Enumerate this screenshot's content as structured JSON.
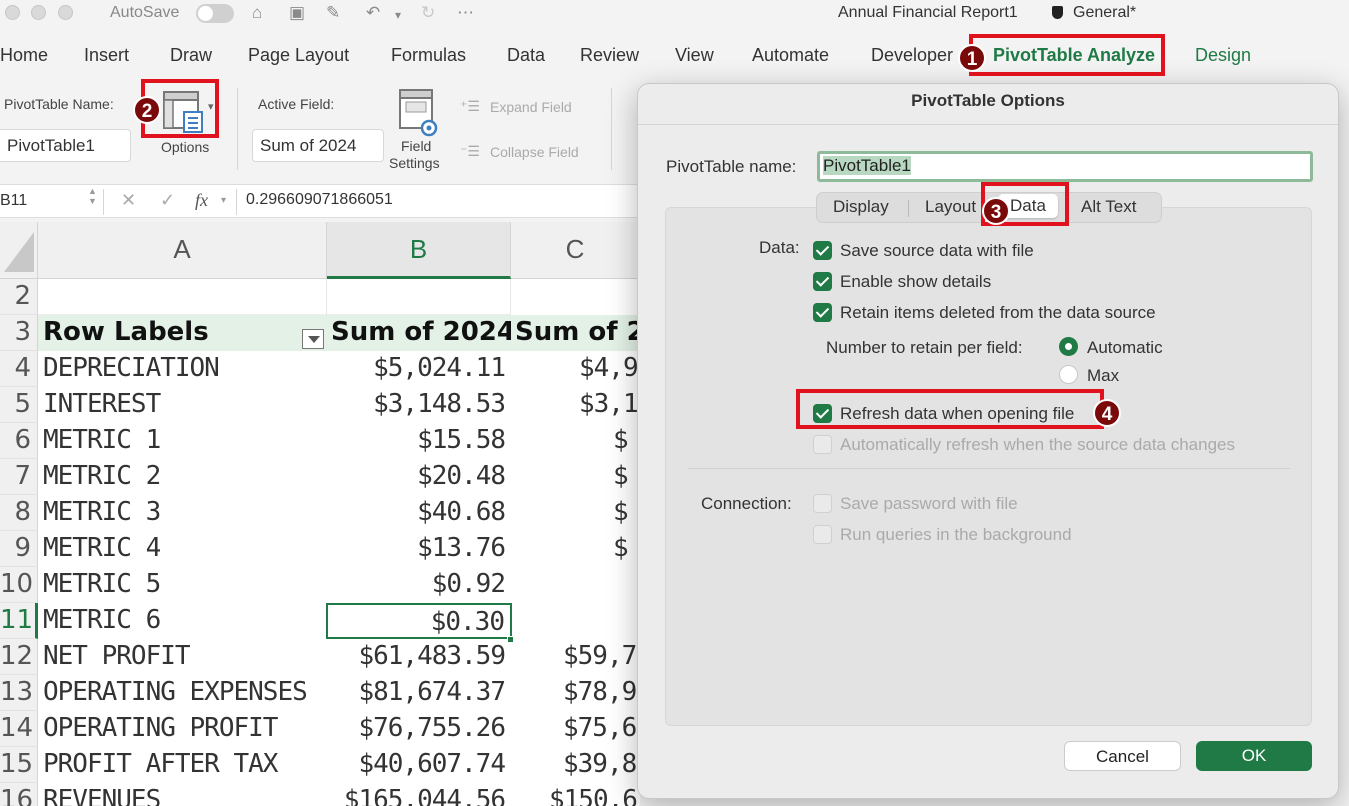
{
  "app": {
    "autosave_label": "AutoSave",
    "doc_title": "Annual Financial Report1",
    "sensitivity": "General*"
  },
  "tabs": [
    "Home",
    "Insert",
    "Draw",
    "Page Layout",
    "Formulas",
    "Data",
    "Review",
    "View",
    "Automate",
    "Developer",
    "PivotTable Analyze",
    "Design"
  ],
  "ribbon": {
    "pivot_name_label": "PivotTable Name:",
    "pivot_name_value": "PivotTable1",
    "options_label": "Options",
    "active_field_label": "Active Field:",
    "active_field_value": "Sum of 2024",
    "field_settings_label_1": "Field",
    "field_settings_label_2": "Settings",
    "expand_field": "Expand Field",
    "collapse_field": "Collapse Field"
  },
  "formula_bar": {
    "name_box": "B11",
    "fx": "fx",
    "value": "0.296609071866051"
  },
  "sheet": {
    "columns": [
      "A",
      "B",
      "C"
    ],
    "header_row": {
      "num": "3",
      "a": "Row Labels",
      "b": "Sum of 2024",
      "c": "Sum of 2"
    },
    "rows": [
      {
        "num": "2",
        "a": "",
        "b": "",
        "c": ""
      },
      {
        "num": "4",
        "a": "DEPRECIATION",
        "b": "$5,024.11",
        "c": "$4,9"
      },
      {
        "num": "5",
        "a": "INTEREST",
        "b": "$3,148.53",
        "c": "$3,1"
      },
      {
        "num": "6",
        "a": "METRIC 1",
        "b": "$15.58",
        "c": "$"
      },
      {
        "num": "7",
        "a": "METRIC 2",
        "b": "$20.48",
        "c": "$"
      },
      {
        "num": "8",
        "a": "METRIC 3",
        "b": "$40.68",
        "c": "$"
      },
      {
        "num": "9",
        "a": "METRIC 4",
        "b": "$13.76",
        "c": "$"
      },
      {
        "num": "10",
        "a": "METRIC 5",
        "b": "$0.92",
        "c": ""
      },
      {
        "num": "11",
        "a": "METRIC 6",
        "b": "$0.30",
        "c": ""
      },
      {
        "num": "12",
        "a": "NET PROFIT",
        "b": "$61,483.59",
        "c": "$59,7"
      },
      {
        "num": "13",
        "a": "OPERATING EXPENSES",
        "b": "$81,674.37",
        "c": "$78,9"
      },
      {
        "num": "14",
        "a": "OPERATING PROFIT",
        "b": "$76,755.26",
        "c": "$75,6"
      },
      {
        "num": "15",
        "a": "PROFIT AFTER TAX",
        "b": "$40,607.74",
        "c": "$39,8"
      },
      {
        "num": "16",
        "a": "REVENUES",
        "b": "$165,044.56",
        "c": "$150,6"
      }
    ]
  },
  "dialog": {
    "title": "PivotTable Options",
    "name_label": "PivotTable name:",
    "name_value": "PivotTable1",
    "tabs": [
      "Display",
      "Layout",
      "Data",
      "Alt Text"
    ],
    "data_label": "Data:",
    "options": [
      "Save source data with file",
      "Enable show details",
      "Retain items deleted from the data source"
    ],
    "retain_label": "Number to retain per field:",
    "radio_automatic": "Automatic",
    "radio_max": "Max",
    "refresh_label": "Refresh data when opening file",
    "auto_refresh_label": "Automatically refresh when the source data changes",
    "connection_label": "Connection:",
    "save_password": "Save password with file",
    "run_background": "Run queries in the background",
    "cancel": "Cancel",
    "ok": "OK"
  },
  "annotations": [
    "1",
    "2",
    "3",
    "4"
  ],
  "colors": {
    "accent": "#1f7a45",
    "highlight": "#e0121e",
    "badge": "#7a0a0a"
  },
  "icons": [
    "close-icon",
    "minimize-icon",
    "zoom-icon",
    "home-icon",
    "save-icon",
    "edit-icon",
    "undo-icon",
    "redo-icon",
    "more-icon",
    "shield-icon",
    "options-icon",
    "field-settings-icon",
    "expand-icon",
    "collapse-icon",
    "cancel-x-icon",
    "enter-check-icon",
    "function-icon"
  ]
}
